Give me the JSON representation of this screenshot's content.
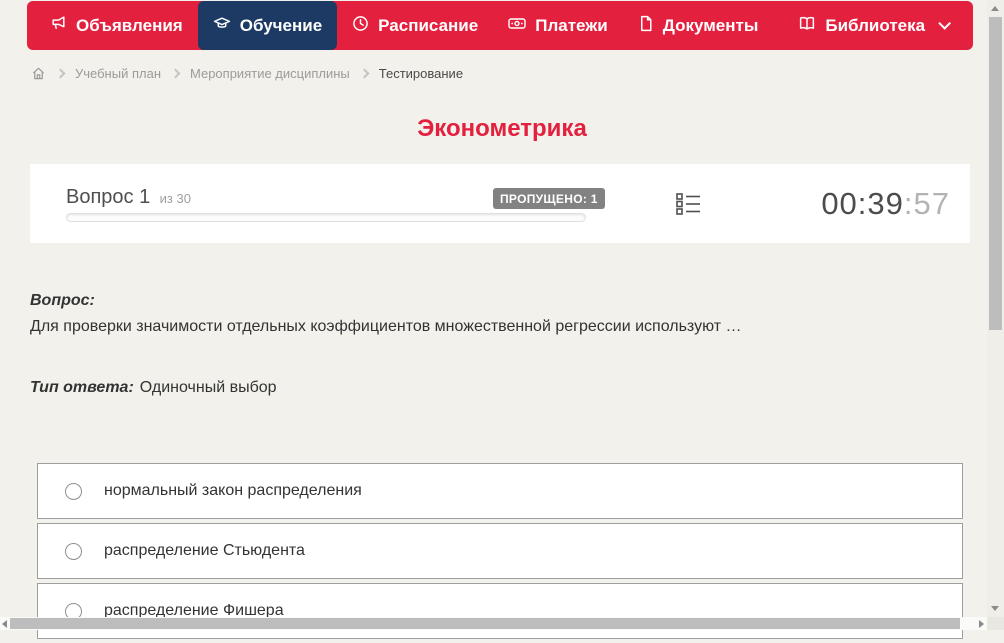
{
  "nav": {
    "items": [
      {
        "label": "Объявления",
        "icon": "megaphone-icon",
        "active": false
      },
      {
        "label": "Обучение",
        "icon": "graduation-cap-icon",
        "active": true
      },
      {
        "label": "Расписание",
        "icon": "clock-icon",
        "active": false
      },
      {
        "label": "Платежи",
        "icon": "banknote-icon",
        "active": false
      },
      {
        "label": "Документы",
        "icon": "document-icon",
        "active": false
      },
      {
        "label": "Библиотека",
        "icon": "open-book-icon",
        "active": false,
        "has_dropdown": true
      }
    ]
  },
  "breadcrumb": {
    "items": [
      {
        "label": "Учебный план",
        "current": false
      },
      {
        "label": "Мероприятие дисциплины",
        "current": false
      },
      {
        "label": "Тестирование",
        "current": true
      }
    ]
  },
  "page_title": "Эконометрика",
  "question_card": {
    "question_number": "Вопрос 1",
    "question_total": "из 30",
    "skipped_badge": "ПРОПУЩЕНО: 1",
    "progress_percent": 0,
    "timer_main": "00:39",
    "timer_seconds": ":57"
  },
  "question": {
    "label": "Вопрос:",
    "text": "Для проверки значимости отдельных коэффициентов множественной регрессии используют …",
    "answer_type_label": "Тип ответа:",
    "answer_type_value": "Одиночный выбор"
  },
  "options": [
    {
      "label": "нормальный закон распределения",
      "selected": false
    },
    {
      "label": "распределение Стьюдента",
      "selected": false
    },
    {
      "label": "распределение Фишера",
      "selected": false
    }
  ],
  "colors": {
    "accent_red": "#e4203f",
    "active_navy": "#1c3a64",
    "page_background": "#f2f1ec",
    "badge_gray": "#828282"
  }
}
